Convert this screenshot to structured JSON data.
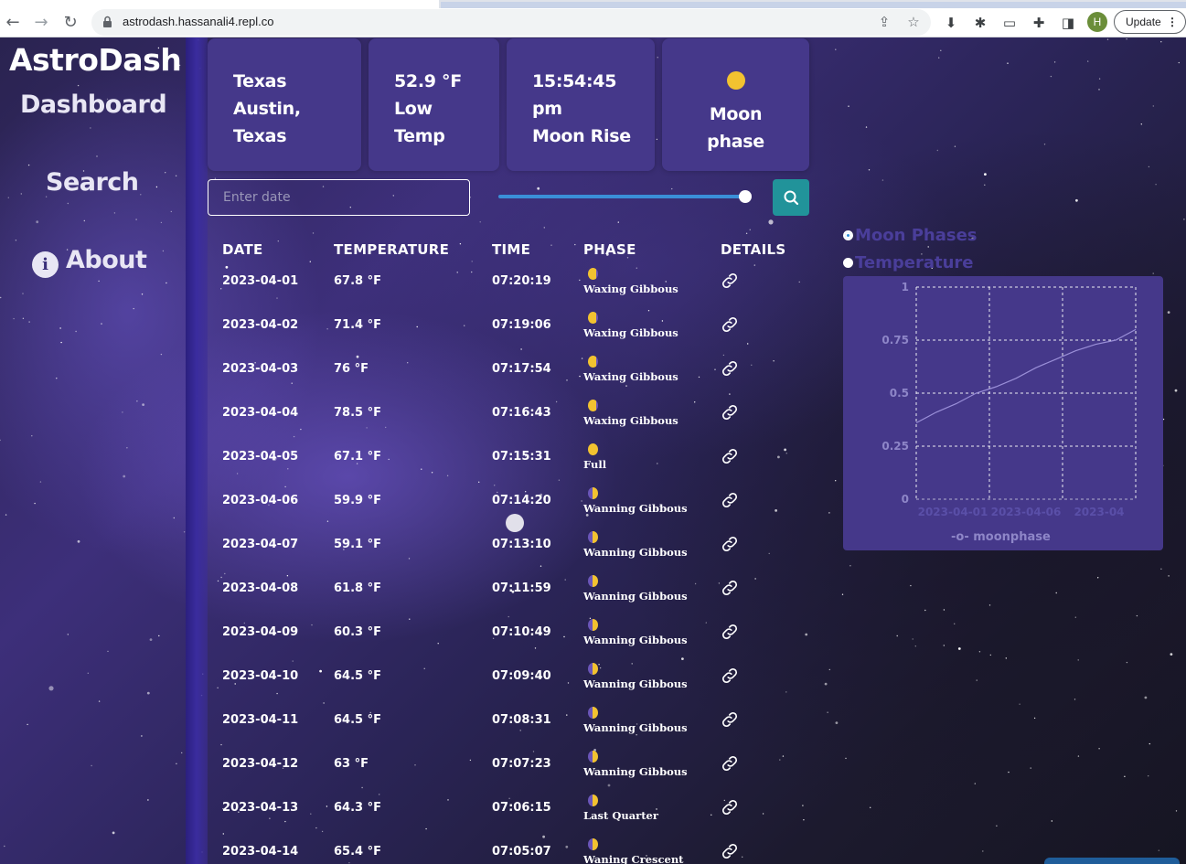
{
  "browser": {
    "url": "astrodash.hassanali4.repl.co",
    "avatar_letter": "H",
    "update_label": "Update"
  },
  "sidebar": {
    "brand": "AstroDash",
    "items": [
      {
        "label": "Dashboard"
      },
      {
        "label": "Search"
      },
      {
        "label": "About",
        "icon": "info-icon"
      }
    ]
  },
  "cards": [
    {
      "lines": [
        "Texas",
        "Austin,",
        "Texas"
      ]
    },
    {
      "lines": [
        "52.9 °F",
        "Low",
        "Temp"
      ]
    },
    {
      "lines": [
        "15:54:45",
        "pm",
        "Moon Rise"
      ]
    },
    {
      "lines": [
        "Moon",
        "phase"
      ],
      "icon": "moon-dot-icon"
    }
  ],
  "search": {
    "placeholder": "Enter date",
    "slider_fraction": 1.0
  },
  "table": {
    "headers": [
      "DATE",
      "TEMPERATURE",
      "TIME",
      "PHASE",
      "DETAILS"
    ],
    "rows": [
      {
        "date": "2023-04-01",
        "temp": "67.8 °F",
        "time": "07:20:19",
        "phase": "Waxing Gibbous"
      },
      {
        "date": "2023-04-02",
        "temp": "71.4 °F",
        "time": "07:19:06",
        "phase": "Waxing Gibbous"
      },
      {
        "date": "2023-04-03",
        "temp": "76 °F",
        "time": "07:17:54",
        "phase": "Waxing Gibbous"
      },
      {
        "date": "2023-04-04",
        "temp": "78.5 °F",
        "time": "07:16:43",
        "phase": "Waxing Gibbous"
      },
      {
        "date": "2023-04-05",
        "temp": "67.1 °F",
        "time": "07:15:31",
        "phase": "Full"
      },
      {
        "date": "2023-04-06",
        "temp": "59.9 °F",
        "time": "07:14:20",
        "phase": "Wanning Gibbous"
      },
      {
        "date": "2023-04-07",
        "temp": "59.1 °F",
        "time": "07:13:10",
        "phase": "Wanning Gibbous"
      },
      {
        "date": "2023-04-08",
        "temp": "61.8 °F",
        "time": "07:11:59",
        "phase": "Wanning Gibbous"
      },
      {
        "date": "2023-04-09",
        "temp": "60.3 °F",
        "time": "07:10:49",
        "phase": "Wanning Gibbous"
      },
      {
        "date": "2023-04-10",
        "temp": "64.5 °F",
        "time": "07:09:40",
        "phase": "Wanning Gibbous"
      },
      {
        "date": "2023-04-11",
        "temp": "64.5 °F",
        "time": "07:08:31",
        "phase": "Wanning Gibbous"
      },
      {
        "date": "2023-04-12",
        "temp": "63 °F",
        "time": "07:07:23",
        "phase": "Wanning Gibbous"
      },
      {
        "date": "2023-04-13",
        "temp": "64.3 °F",
        "time": "07:06:15",
        "phase": "Last Quarter"
      },
      {
        "date": "2023-04-14",
        "temp": "65.4 °F",
        "time": "07:05:07",
        "phase": "Waning Crescent"
      }
    ]
  },
  "chart_toggle": {
    "options": [
      "Moon Phases",
      "Temperature"
    ],
    "selected": "Moon Phases"
  },
  "chart_data": {
    "type": "line",
    "x": [
      "2023-04-01",
      "2023-04-02",
      "2023-04-03",
      "2023-04-04",
      "2023-04-05",
      "2023-04-06",
      "2023-04-07",
      "2023-04-08",
      "2023-04-09",
      "2023-04-10",
      "2023-04-11",
      "2023-04-12"
    ],
    "x_tick_labels": [
      "2023-04-01",
      "2023-04-06",
      "2023-04"
    ],
    "series": [
      {
        "name": "moonphase",
        "values": [
          0.36,
          0.41,
          0.45,
          0.5,
          0.53,
          0.57,
          0.62,
          0.66,
          0.7,
          0.73,
          0.75,
          0.8
        ]
      }
    ],
    "ylim": [
      0,
      1
    ],
    "y_ticks": [
      "0",
      "0.25",
      "0.5",
      "0.75",
      "1"
    ],
    "legend": "bottom",
    "grid": true,
    "line_color": "#9a8fd8",
    "grid_color": "#ffffff"
  },
  "colors": {
    "card_bg": "#45388a",
    "accent_teal": "#21939a",
    "moon_yellow": "#f2c230",
    "slider_blue": "#3a8fd8"
  }
}
